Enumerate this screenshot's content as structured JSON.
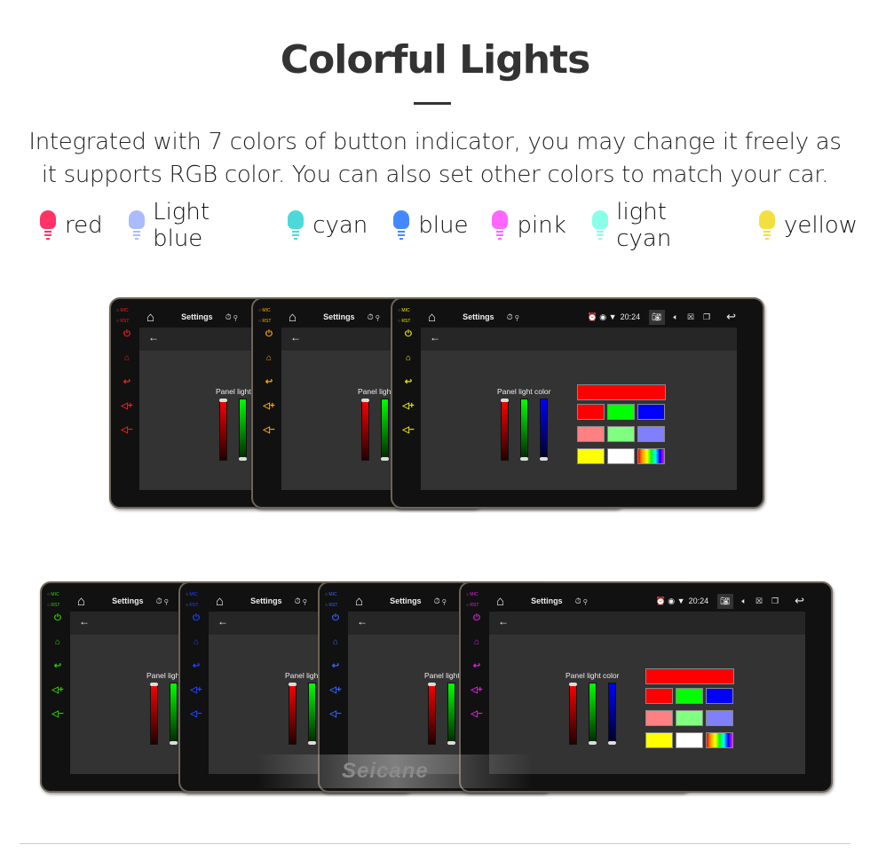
{
  "title": "Colorful Lights",
  "description": [
    "Integrated with 7 colors of button indicator, you may change it freely as",
    "it supports RGB color. You can also set other colors to match your car."
  ],
  "legend": [
    {
      "label": "red",
      "color": "#ff3366"
    },
    {
      "label": "Light blue",
      "color": "#aabbff"
    },
    {
      "label": "cyan",
      "color": "#4dd9d9"
    },
    {
      "label": "blue",
      "color": "#4488ff"
    },
    {
      "label": "pink",
      "color": "#ff66ff"
    },
    {
      "label": "light cyan",
      "color": "#88ffe6"
    },
    {
      "label": "yellow",
      "color": "#f2e040"
    }
  ],
  "screen": {
    "app_title": "Settings",
    "panel_label": "Panel light color",
    "time": "20:24",
    "mic": "MIC",
    "rst": "RST"
  },
  "sliders": {
    "red": 1.0,
    "green": 0.0,
    "blue": 0.0
  },
  "swatches": {
    "top": "#ff0000",
    "rows": [
      [
        "#ff0000",
        "#00ff00",
        "#0000ff"
      ],
      [
        "#ff8080",
        "#80ff80",
        "#8080ff"
      ],
      [
        "#ffff00",
        "#ffffff",
        "rainbow"
      ]
    ]
  },
  "devices": [
    {
      "row": "top",
      "button_color": "#ff1a1a"
    },
    {
      "row": "top",
      "button_color": "#ffaa00"
    },
    {
      "row": "top",
      "button_color": "#e6e600"
    },
    {
      "row": "bottom",
      "button_color": "#33cc00"
    },
    {
      "row": "bottom",
      "button_color": "#2244ff"
    },
    {
      "row": "bottom",
      "button_color": "#3366ff"
    },
    {
      "row": "bottom",
      "button_color": "#dd22dd"
    }
  ],
  "watermark": "Seicane"
}
